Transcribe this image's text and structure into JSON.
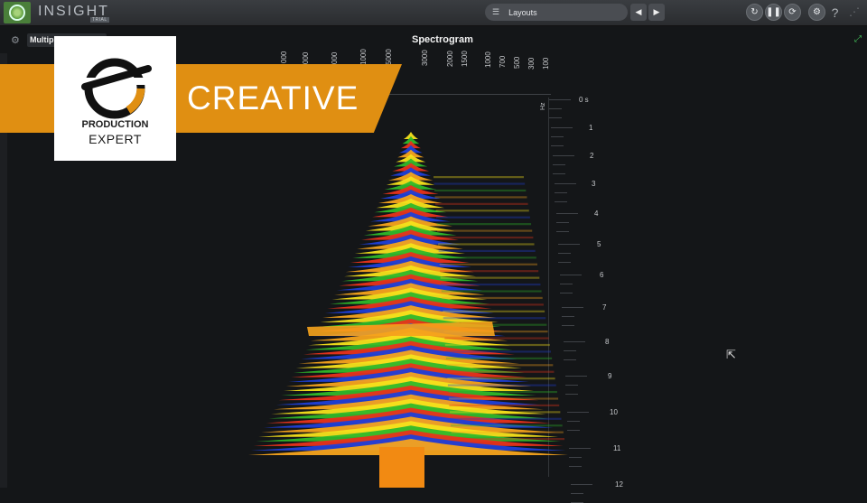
{
  "app": {
    "title": "INSIGHT",
    "badge": "TRIAL"
  },
  "toolbar": {
    "layouts_label": "Layouts",
    "prev_icon": "◀",
    "next_icon": "▶",
    "actions": [
      "reset-icon",
      "pause-icon",
      "loop-icon",
      "settings-icon",
      "help-icon"
    ]
  },
  "panel": {
    "title": "Spectrogram",
    "dropdown_value": "Multiple"
  },
  "spectrogram": {
    "freq_labels": [
      "000",
      "000",
      "000",
      "1000",
      "5000",
      "3000",
      "2000",
      "1500",
      "1000",
      "700",
      "500",
      "300",
      "100"
    ],
    "freq_unit": "Hz",
    "time_labels": [
      "0 s",
      "1",
      "2",
      "3",
      "4",
      "5",
      "6",
      "7",
      "8",
      "9",
      "10",
      "11",
      "12"
    ]
  },
  "overlay": {
    "banner_text": "CREATIVE",
    "brand_line1": "PRODUCTION",
    "brand_line2": "EXPERT"
  }
}
